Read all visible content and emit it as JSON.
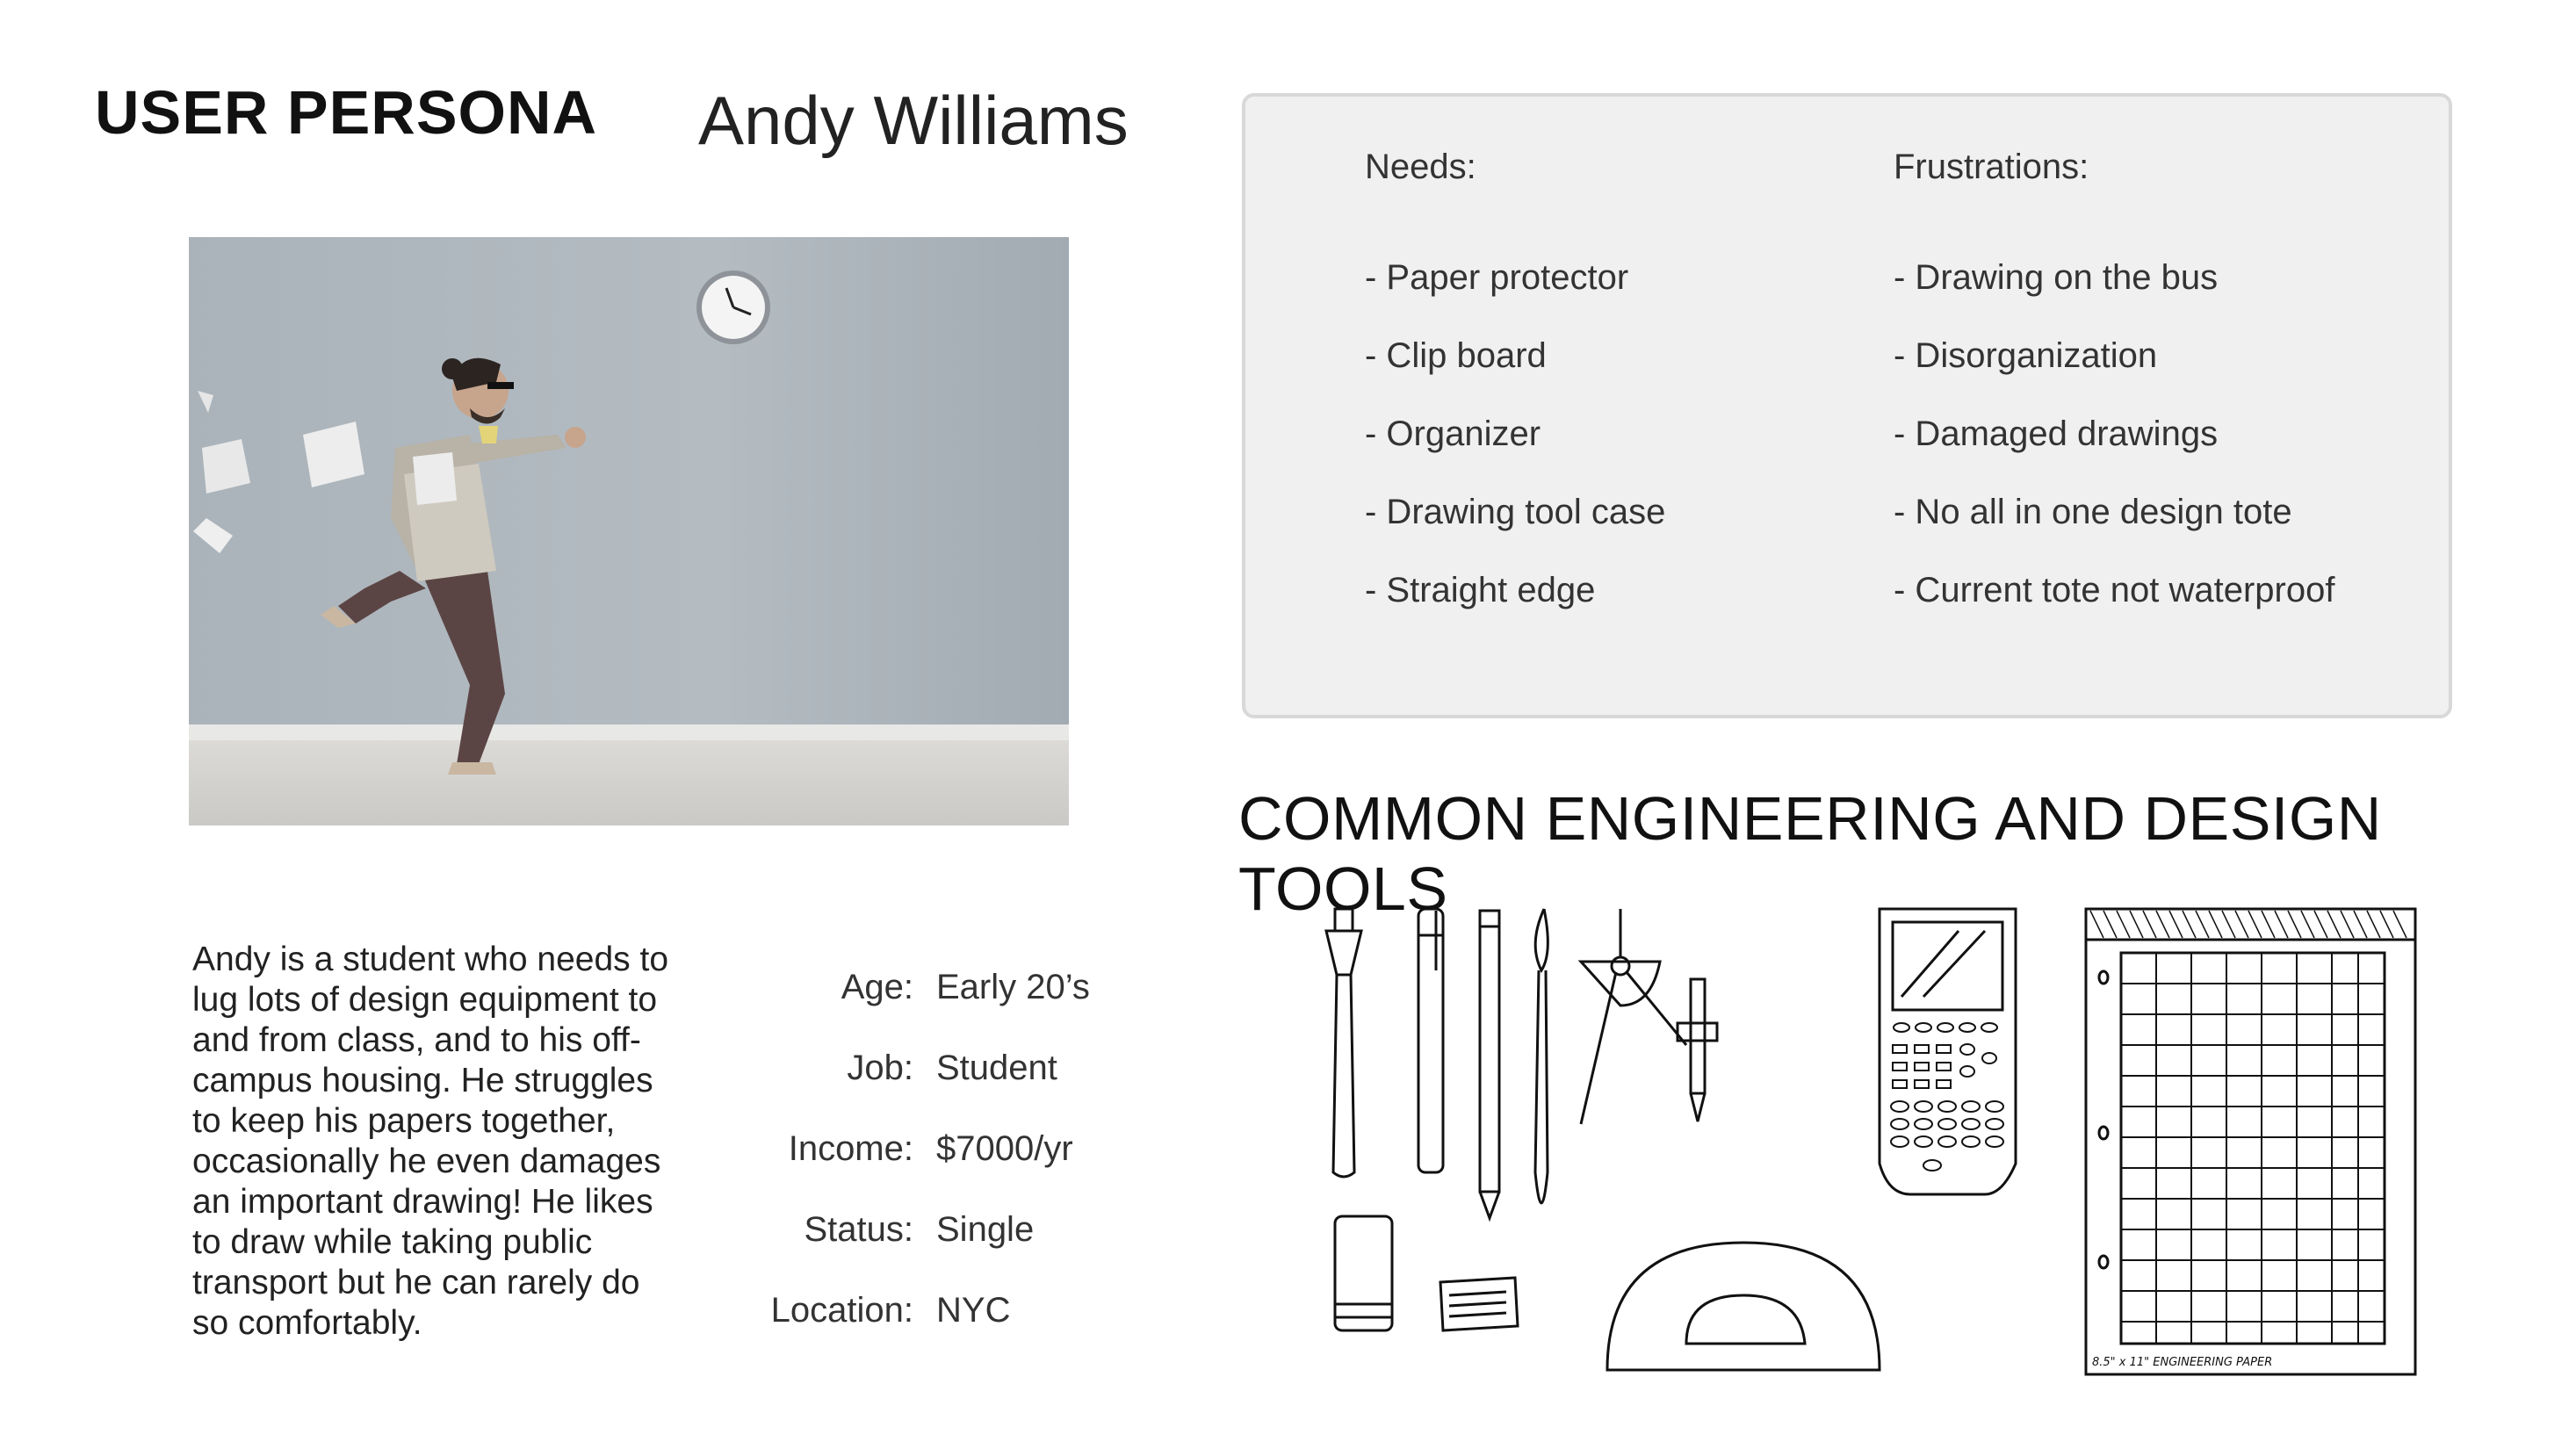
{
  "header": {
    "title": "USER PERSONA",
    "name": "Andy Williams"
  },
  "bio": "Andy is a student who needs to lug lots of design equipment to and from class, and to his off-campus housing. He struggles to keep his papers together, occasionally he even damages an important drawing! He likes to draw while taking public transport but he can rarely do so comfortably.",
  "details": [
    {
      "label": "Age:",
      "value": "Early 20’s"
    },
    {
      "label": "Job:",
      "value": "Student"
    },
    {
      "label": "Income:",
      "value": "$7000/yr"
    },
    {
      "label": "Status:",
      "value": "Single"
    },
    {
      "label": "Location:",
      "value": "NYC"
    }
  ],
  "needs": {
    "heading": "Needs:",
    "items": [
      "- Paper protector",
      "- Clip board",
      "- Organizer",
      "- Drawing tool case",
      "- Straight edge"
    ]
  },
  "frustrations": {
    "heading": "Frustrations:",
    "items": [
      "- Drawing on the bus",
      "- Disorganization",
      "- Damaged drawings",
      "- No all in one design tote",
      "- Current tote not waterproof"
    ]
  },
  "tools": {
    "title": "COMMON ENGINEERING AND DESIGN TOOLS",
    "paper_caption": "8.5\" x 11\" ENGINEERING PAPER"
  },
  "colors": {
    "panel_bg": "#f0f0f0",
    "panel_border": "#d8d8d8",
    "wall": "#a9b1b8",
    "floor": "#d5d3d0"
  }
}
